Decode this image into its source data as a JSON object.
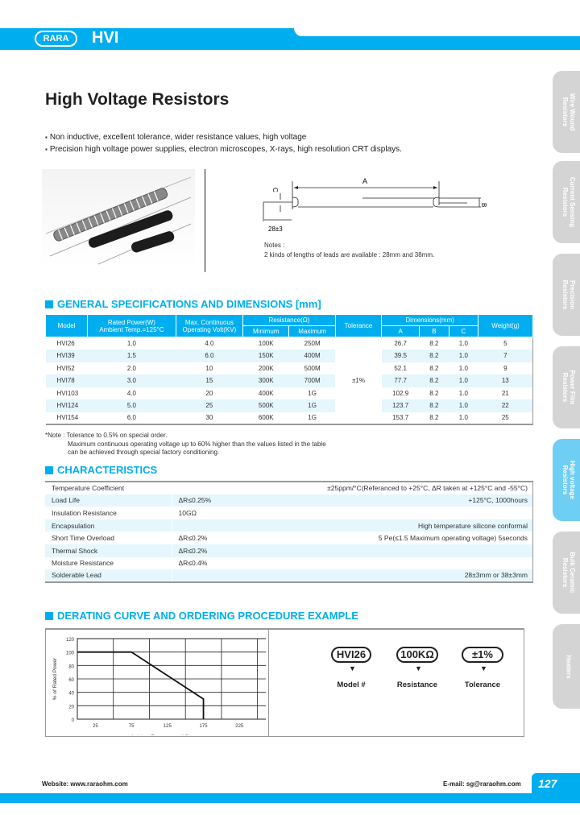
{
  "header": {
    "logo": "RARA",
    "series_code": "HVI"
  },
  "page_title": "High Voltage Resistors",
  "bullets": [
    "Non inductive, excellent tolerance, wider resistance values, high voltage",
    "Precision high voltage power supplies, electron microscopes, X-rays, high resolution CRT displays."
  ],
  "diagram": {
    "label_a": "A",
    "label_b": "B",
    "label_c": "C",
    "lead_length": "28±3",
    "notes_title": "Notes :",
    "notes_text": "2 kinds of lengths of leads are available : 28mm and 38mm."
  },
  "spec_section": {
    "title": "GENERAL SPECIFICATIONS AND DIMENSIONS [mm]",
    "headers": {
      "model": "Model",
      "rated_power_1": "Rated Power(W)",
      "rated_power_2": "Ambient Temp.=125°C",
      "max_volt_1": "Max. Continuous",
      "max_volt_2": "Operating Volt(KV)",
      "resistance": "Resistance(Ω)",
      "minimum": "Minimum",
      "maximum": "Maximum",
      "tolerance": "Tolerance",
      "dimensions": "Dimensions(mm)",
      "a": "A",
      "b": "B",
      "c": "C",
      "weight": "Weight(g)"
    },
    "tolerance_value": "±1%",
    "rows": [
      {
        "model": "HVI26",
        "power": "1.0",
        "volt": "4.0",
        "min": "100K",
        "max": "250M",
        "a": "26.7",
        "b": "8.2",
        "c": "1.0",
        "weight": "5"
      },
      {
        "model": "HVI39",
        "power": "1.5",
        "volt": "6.0",
        "min": "150K",
        "max": "400M",
        "a": "39.5",
        "b": "8.2",
        "c": "1.0",
        "weight": "7"
      },
      {
        "model": "HVI52",
        "power": "2.0",
        "volt": "10",
        "min": "200K",
        "max": "500M",
        "a": "52.1",
        "b": "8.2",
        "c": "1.0",
        "weight": "9"
      },
      {
        "model": "HVI78",
        "power": "3.0",
        "volt": "15",
        "min": "300K",
        "max": "700M",
        "a": "77.7",
        "b": "8.2",
        "c": "1.0",
        "weight": "13"
      },
      {
        "model": "HVI103",
        "power": "4.0",
        "volt": "20",
        "min": "400K",
        "max": "1G",
        "a": "102.9",
        "b": "8.2",
        "c": "1.0",
        "weight": "21"
      },
      {
        "model": "HVI124",
        "power": "5.0",
        "volt": "25",
        "min": "500K",
        "max": "1G",
        "a": "123.7",
        "b": "8.2",
        "c": "1.0",
        "weight": "22"
      },
      {
        "model": "HVI154",
        "power": "6.0",
        "volt": "30",
        "min": "600K",
        "max": "1G",
        "a": "153.7",
        "b": "8.2",
        "c": "1.0",
        "weight": "25"
      }
    ],
    "notes": [
      "*Note : Tolerance to 0.5% on special order.",
      "Maximum continuous operating voltage up to 60% higher than the values listed in the table",
      "can be achieved through special factory conditioning."
    ]
  },
  "characteristics": {
    "title": "CHARACTERISTICS",
    "rows": [
      {
        "label": "Temperature Coefficient",
        "value": "",
        "condition": "±25ppm/°C(Referanced to +25°C, ΔR taken at +125°C and -55°C)"
      },
      {
        "label": "Load Life",
        "value": "ΔR≤0.25%",
        "condition": "+125°C, 1000hours"
      },
      {
        "label": "Insulation Resistance",
        "value": "10GΩ",
        "condition": ""
      },
      {
        "label": "Encapsulation",
        "value": "",
        "condition": "High temperature silicone conformal"
      },
      {
        "label": "Short Time Overload",
        "value": "ΔR≤0.2%",
        "condition": "5 Pe(≤1.5 Maximum operating voltage) 5seconds"
      },
      {
        "label": "Thermal Shock",
        "value": "ΔR≤0.2%",
        "condition": ""
      },
      {
        "label": "Moisture Resistance",
        "value": "ΔR≤0.4%",
        "condition": ""
      },
      {
        "label": "Solderable Lead",
        "value": "",
        "condition": "28±3mm or 38±3mm"
      }
    ]
  },
  "derating": {
    "title": "DERATING CURVE AND ORDERING PROCEDURE EXAMPLE",
    "ordering": [
      {
        "code": "HVI26",
        "label": "Model #"
      },
      {
        "code": "100KΩ",
        "label": "Resistance"
      },
      {
        "code": "±1%",
        "label": "Tolerance"
      }
    ]
  },
  "chart_data": {
    "type": "line",
    "title": "",
    "xlabel": "Ambient Temperature(°C)",
    "ylabel": "% of Rated Power",
    "x_ticks": [
      "25",
      "75",
      "125",
      "175",
      "225"
    ],
    "y_ticks": [
      "0",
      "20",
      "40",
      "60",
      "80",
      "100",
      "120"
    ],
    "xlim": [
      0,
      275
    ],
    "ylim": [
      0,
      120
    ],
    "grid": true,
    "series": [
      {
        "name": "derating",
        "x": [
          0,
          75,
          175,
          175
        ],
        "y": [
          100,
          100,
          30,
          0
        ]
      }
    ]
  },
  "side_tabs": [
    {
      "label": "Wire Wound\nResistors",
      "active": false
    },
    {
      "label": "Current Sensing\nResistors",
      "active": false
    },
    {
      "label": "Precision\nResistors",
      "active": false
    },
    {
      "label": "Power Film\nResistors",
      "active": false
    },
    {
      "label": "High voltage\nResistors",
      "active": true
    },
    {
      "label": "Bulk Ceramic\nResistors",
      "active": false
    },
    {
      "label": "Heaters",
      "active": false
    }
  ],
  "footer": {
    "website": "Website: www.raraohm.com",
    "email": "E-mail: sg@raraohm.com",
    "page_number": "127"
  }
}
